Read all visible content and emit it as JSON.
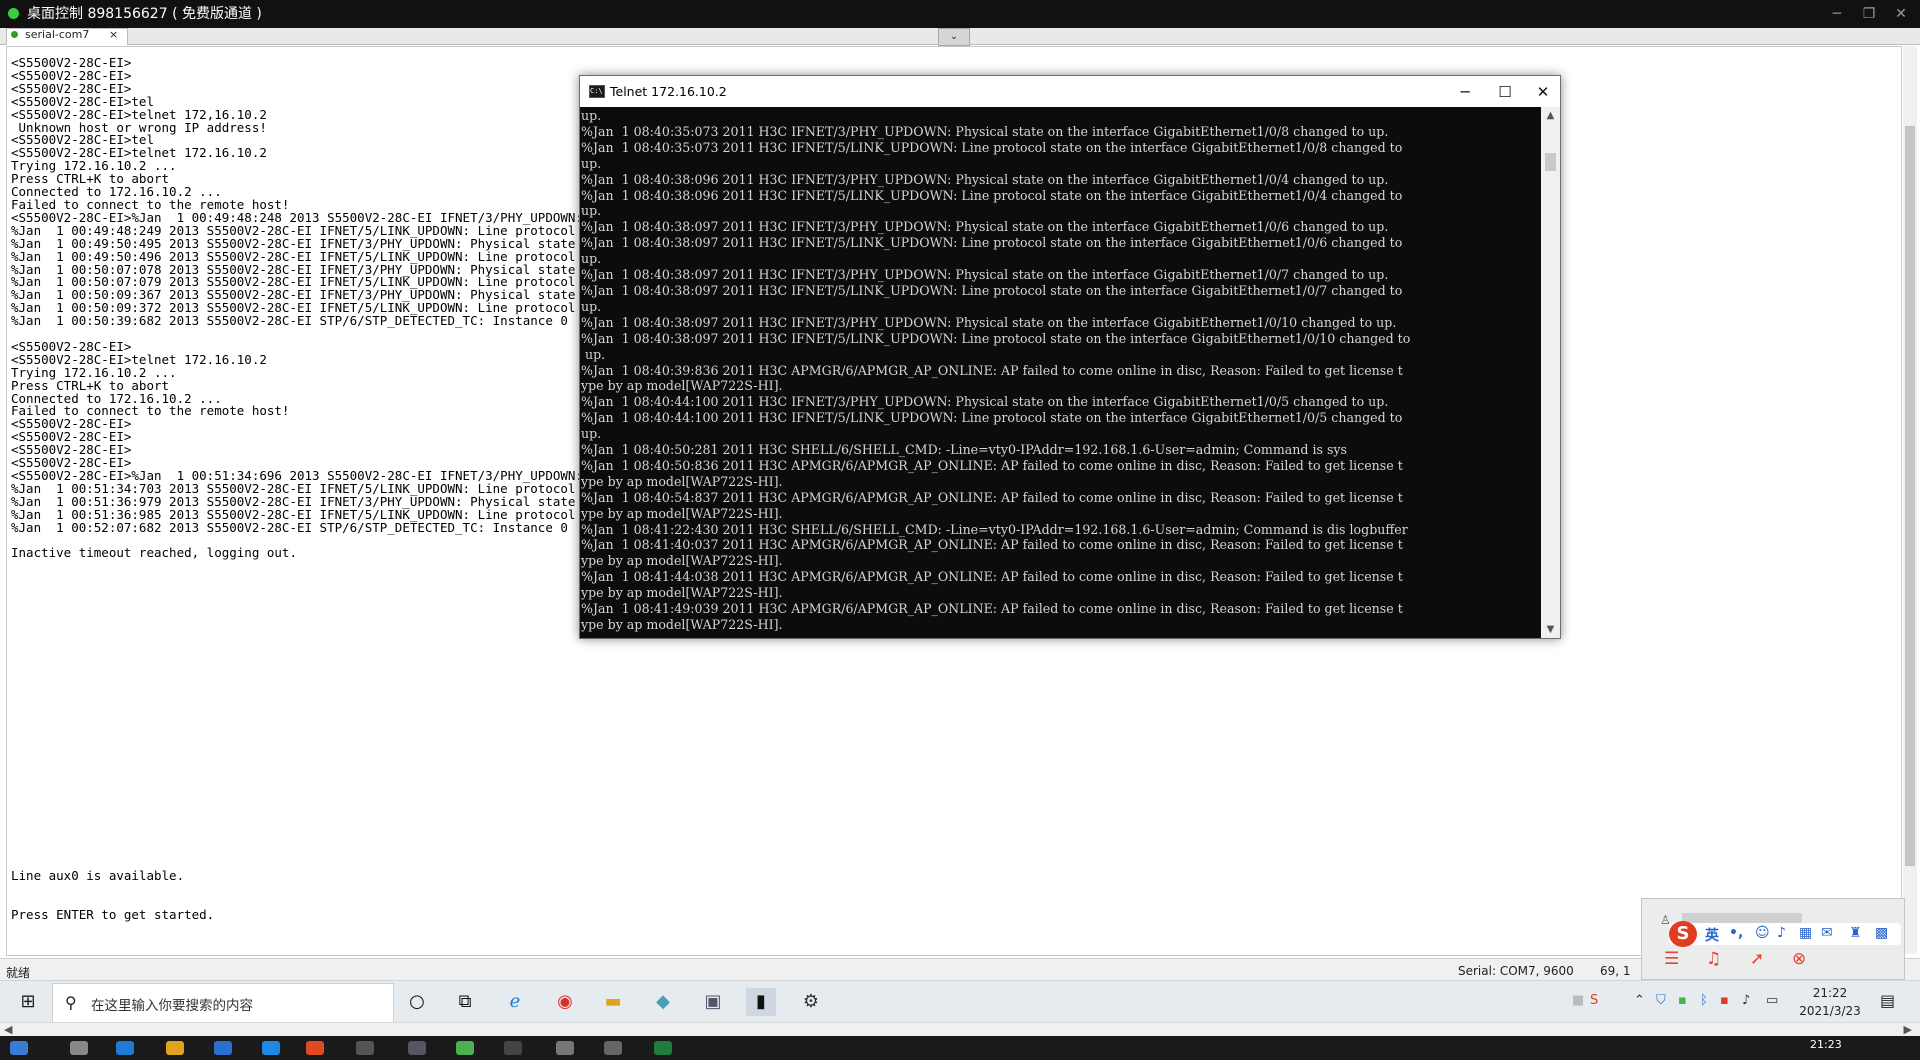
{
  "remote_desktop": {
    "title": "桌面控制 898156627 ( 免费版通道 )",
    "minimize": "─",
    "maximize": "❐",
    "close": "✕"
  },
  "terminal": {
    "tab_label": "serial-com7",
    "tab_close": "×",
    "tab_dropdown": "⌄",
    "lines": [
      "<S5500V2-28C-EI>",
      "<S5500V2-28C-EI>",
      "<S5500V2-28C-EI>",
      "<S5500V2-28C-EI>tel",
      "<S5500V2-28C-EI>telnet 172,16.10.2",
      " Unknown host or wrong IP address!",
      "<S5500V2-28C-EI>tel",
      "<S5500V2-28C-EI>telnet 172.16.10.2",
      "Trying 172.16.10.2 ...",
      "Press CTRL+K to abort",
      "Connected to 172.16.10.2 ...",
      "Failed to connect to the remote host!",
      "<S5500V2-28C-EI>%Jan  1 00:49:48:248 2013 S5500V2-28C-EI IFNET/3/PHY_UPDOWN: Phy",
      "%Jan  1 00:49:48:249 2013 S5500V2-28C-EI IFNET/5/LINK_UPDOWN: Line protocol",
      "%Jan  1 00:49:50:495 2013 S5500V2-28C-EI IFNET/3/PHY_UPDOWN: Physical state",
      "%Jan  1 00:49:50:496 2013 S5500V2-28C-EI IFNET/5/LINK_UPDOWN: Line protocol",
      "%Jan  1 00:50:07:078 2013 S5500V2-28C-EI IFNET/3/PHY_UPDOWN: Physical state",
      "%Jan  1 00:50:07:079 2013 S5500V2-28C-EI IFNET/5/LINK_UPDOWN: Line protocol",
      "%Jan  1 00:50:09:367 2013 S5500V2-28C-EI IFNET/3/PHY_UPDOWN: Physical state",
      "%Jan  1 00:50:09:372 2013 S5500V2-28C-EI IFNET/5/LINK_UPDOWN: Line protocol",
      "%Jan  1 00:50:39:682 2013 S5500V2-28C-EI STP/6/STP_DETECTED_TC: Instance 0",
      "",
      "<S5500V2-28C-EI>",
      "<S5500V2-28C-EI>telnet 172.16.10.2",
      "Trying 172.16.10.2 ...",
      "Press CTRL+K to abort",
      "Connected to 172.16.10.2 ...",
      "Failed to connect to the remote host!",
      "<S5500V2-28C-EI>",
      "<S5500V2-28C-EI>",
      "<S5500V2-28C-EI>",
      "<S5500V2-28C-EI>",
      "<S5500V2-28C-EI>%Jan  1 00:51:34:696 2013 S5500V2-28C-EI IFNET/3/PHY_UPDOWN: Phy",
      "%Jan  1 00:51:34:703 2013 S5500V2-28C-EI IFNET/5/LINK_UPDOWN: Line protocol",
      "%Jan  1 00:51:36:979 2013 S5500V2-28C-EI IFNET/3/PHY_UPDOWN: Physical state",
      "%Jan  1 00:51:36:985 2013 S5500V2-28C-EI IFNET/5/LINK_UPDOWN: Line protocol",
      "%Jan  1 00:52:07:682 2013 S5500V2-28C-EI STP/6/STP_DETECTED_TC: Instance 0",
      "",
      "Inactive timeout reached, logging out."
    ],
    "bottom_line1": "Line aux0 is available.",
    "bottom_line2": "Press ENTER to get started."
  },
  "status_bar": {
    "ready": "就绪",
    "serial": "Serial: COM7, 9600",
    "position": "69,  1"
  },
  "telnet_window": {
    "title": "Telnet 172.16.10.2",
    "icon_text": "C:\\",
    "minimize": "─",
    "maximize": "☐",
    "close": "✕",
    "lines": [
      "up.",
      "%Jan  1 08:40:35:073 2011 H3C IFNET/3/PHY_UPDOWN: Physical state on the interface GigabitEthernet1/0/8 changed to up.",
      "%Jan  1 08:40:35:073 2011 H3C IFNET/5/LINK_UPDOWN: Line protocol state on the interface GigabitEthernet1/0/8 changed to",
      "up.",
      "%Jan  1 08:40:38:096 2011 H3C IFNET/3/PHY_UPDOWN: Physical state on the interface GigabitEthernet1/0/4 changed to up.",
      "%Jan  1 08:40:38:096 2011 H3C IFNET/5/LINK_UPDOWN: Line protocol state on the interface GigabitEthernet1/0/4 changed to",
      "up.",
      "%Jan  1 08:40:38:097 2011 H3C IFNET/3/PHY_UPDOWN: Physical state on the interface GigabitEthernet1/0/6 changed to up.",
      "%Jan  1 08:40:38:097 2011 H3C IFNET/5/LINK_UPDOWN: Line protocol state on the interface GigabitEthernet1/0/6 changed to",
      "up.",
      "%Jan  1 08:40:38:097 2011 H3C IFNET/3/PHY_UPDOWN: Physical state on the interface GigabitEthernet1/0/7 changed to up.",
      "%Jan  1 08:40:38:097 2011 H3C IFNET/5/LINK_UPDOWN: Line protocol state on the interface GigabitEthernet1/0/7 changed to",
      "up.",
      "%Jan  1 08:40:38:097 2011 H3C IFNET/3/PHY_UPDOWN: Physical state on the interface GigabitEthernet1/0/10 changed to up.",
      "%Jan  1 08:40:38:097 2011 H3C IFNET/5/LINK_UPDOWN: Line protocol state on the interface GigabitEthernet1/0/10 changed to",
      " up.",
      "%Jan  1 08:40:39:836 2011 H3C APMGR/6/APMGR_AP_ONLINE: AP failed to come online in disc, Reason: Failed to get license t",
      "ype by ap model[WAP722S-HI].",
      "%Jan  1 08:40:44:100 2011 H3C IFNET/3/PHY_UPDOWN: Physical state on the interface GigabitEthernet1/0/5 changed to up.",
      "%Jan  1 08:40:44:100 2011 H3C IFNET/5/LINK_UPDOWN: Line protocol state on the interface GigabitEthernet1/0/5 changed to",
      "up.",
      "%Jan  1 08:40:50:281 2011 H3C SHELL/6/SHELL_CMD: -Line=vty0-IPAddr=192.168.1.6-User=admin; Command is sys",
      "%Jan  1 08:40:50:836 2011 H3C APMGR/6/APMGR_AP_ONLINE: AP failed to come online in disc, Reason: Failed to get license t",
      "ype by ap model[WAP722S-HI].",
      "%Jan  1 08:40:54:837 2011 H3C APMGR/6/APMGR_AP_ONLINE: AP failed to come online in disc, Reason: Failed to get license t",
      "ype by ap model[WAP722S-HI].",
      "%Jan  1 08:41:22:430 2011 H3C SHELL/6/SHELL_CMD: -Line=vty0-IPAddr=192.168.1.6-User=admin; Command is dis logbuffer",
      "%Jan  1 08:41:40:037 2011 H3C APMGR/6/APMGR_AP_ONLINE: AP failed to come online in disc, Reason: Failed to get license t",
      "ype by ap model[WAP722S-HI].",
      "%Jan  1 08:41:44:038 2011 H3C APMGR/6/APMGR_AP_ONLINE: AP failed to come online in disc, Reason: Failed to get license t",
      "ype by ap model[WAP722S-HI].",
      "%Jan  1 08:41:49:039 2011 H3C APMGR/6/APMGR_AP_ONLINE: AP failed to come online in disc, Reason: Failed to get license t",
      "ype by ap model[WAP722S-HI]."
    ]
  },
  "ime": {
    "lang": "英",
    "punct": "•,"
  },
  "taskbar": {
    "search_placeholder": "在这里输入你要搜索的内容",
    "time": "21:22",
    "date": "2021/3/23"
  },
  "host_taskbar": {
    "time": "21:23"
  },
  "colors": {
    "console_bg": "#0c0c0c",
    "console_fg": "#d6d6d6",
    "remote_title_bg": "#111111",
    "ime_accent": "#e33b22"
  }
}
